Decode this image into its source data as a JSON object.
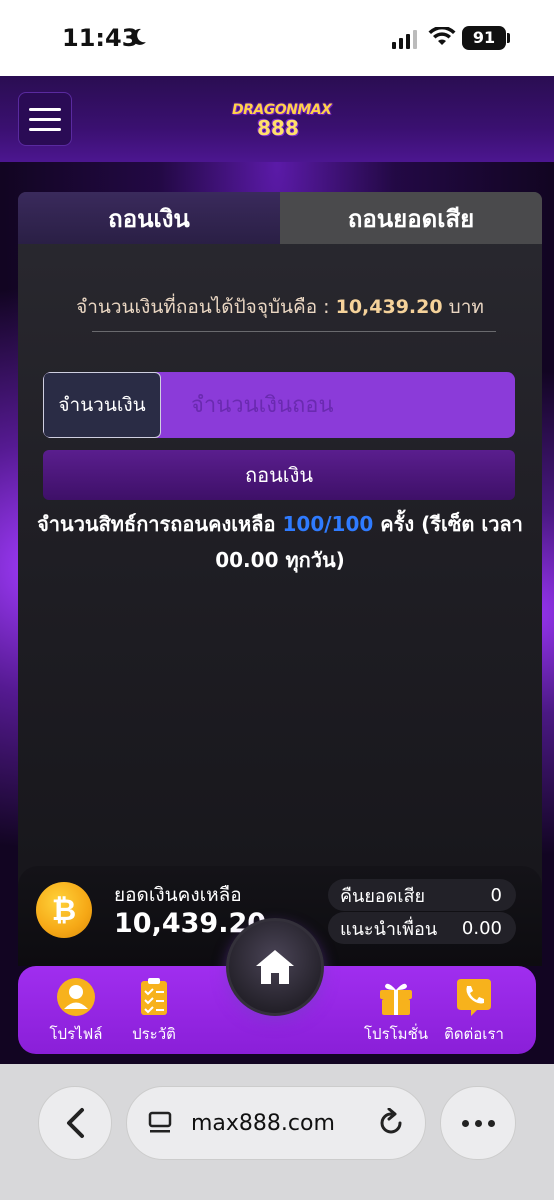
{
  "status_bar": {
    "time": "11:43",
    "battery": "91"
  },
  "header": {
    "logo_top": "DRAGONMAX",
    "logo_num": "888"
  },
  "tabs": [
    {
      "label": "ถอนเงิน",
      "active": true
    },
    {
      "label": "ถอนยอดเสีย",
      "active": false
    }
  ],
  "withdraw": {
    "balance_prefix": "จำนวนเงินที่ถอนได้ปัจจุบันคือ :",
    "balance_amount": "10,439.20",
    "balance_unit": "บาท",
    "amount_label": "จำนวนเงิน",
    "amount_placeholder": "จำนวนเงินถอน",
    "submit_label": "ถอนเงิน",
    "rights_prefix": "จำนวนสิทธ์การถอนคงเหลือ",
    "rights_count": "100/100",
    "rights_suffix": "ครั้ง (รีเซ็ต เวลา 00.00 ทุกวัน)"
  },
  "balance_card": {
    "coin_symbol": "₿",
    "label": "ยอดเงินคงเหลือ",
    "value": "10,439.20",
    "cashback_label": "คืนยอดเสีย",
    "cashback_value": "0",
    "referral_label": "แนะนำเพื่อน",
    "referral_value": "0.00"
  },
  "nav": {
    "profile": "โปรไฟล์",
    "history": "ประวัติ",
    "promotion": "โปรโมชั่น",
    "contact": "ติดต่อเรา"
  },
  "browser": {
    "url": "max888.com"
  },
  "colors": {
    "accent": "#8b3bd9",
    "highlight": "#2f7bff",
    "coin": "#f6a816"
  }
}
